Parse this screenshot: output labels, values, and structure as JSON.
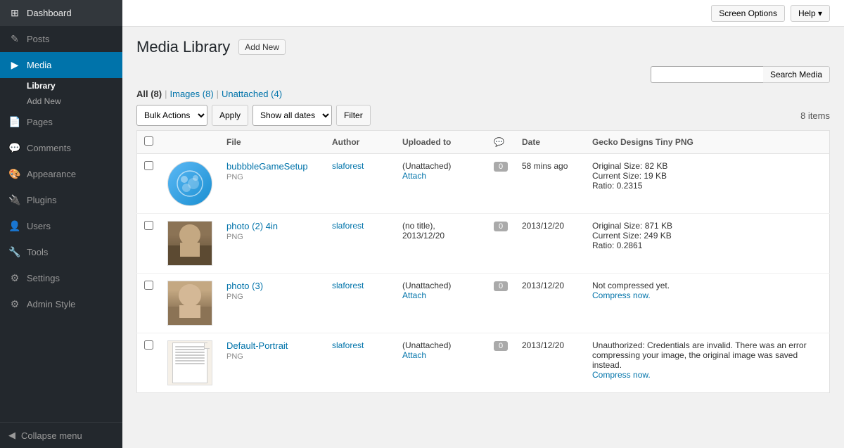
{
  "topbar": {
    "screen_options_label": "Screen Options",
    "help_label": "Help ▾"
  },
  "sidebar": {
    "items": [
      {
        "id": "dashboard",
        "label": "Dashboard",
        "icon": "⊞"
      },
      {
        "id": "posts",
        "label": "Posts",
        "icon": "✎"
      },
      {
        "id": "media",
        "label": "Media",
        "icon": "🖼",
        "active": true
      },
      {
        "id": "pages",
        "label": "Pages",
        "icon": "📄"
      },
      {
        "id": "comments",
        "label": "Comments",
        "icon": "💬"
      },
      {
        "id": "appearance",
        "label": "Appearance",
        "icon": "🎨"
      },
      {
        "id": "plugins",
        "label": "Plugins",
        "icon": "🔌"
      },
      {
        "id": "users",
        "label": "Users",
        "icon": "👤"
      },
      {
        "id": "tools",
        "label": "Tools",
        "icon": "🔧"
      },
      {
        "id": "settings",
        "label": "Settings",
        "icon": "⚙"
      },
      {
        "id": "admin-style",
        "label": "Admin Style",
        "icon": "⚙"
      }
    ],
    "media_sub": [
      {
        "id": "library",
        "label": "Library",
        "active": true
      },
      {
        "id": "add-new",
        "label": "Add New"
      }
    ],
    "collapse_label": "Collapse menu"
  },
  "page": {
    "title": "Media Library",
    "add_new_label": "Add New"
  },
  "search": {
    "placeholder": "",
    "button_label": "Search Media"
  },
  "filter_tabs": [
    {
      "id": "all",
      "label": "All",
      "count": "(8)",
      "active": true
    },
    {
      "id": "images",
      "label": "Images",
      "count": "(8)"
    },
    {
      "id": "unattached",
      "label": "Unattached",
      "count": "(4)"
    }
  ],
  "toolbar": {
    "bulk_actions_label": "Bulk Actions",
    "apply_label": "Apply",
    "show_dates_label": "Show all dates",
    "filter_label": "Filter",
    "item_count": "8 items"
  },
  "table": {
    "headers": {
      "file": "File",
      "author": "Author",
      "uploaded_to": "Uploaded to",
      "comment": "💬",
      "date": "Date",
      "gecko": "Gecko Designs Tiny PNG"
    },
    "rows": [
      {
        "id": "row1",
        "thumb_type": "bubble",
        "file_name": "bubbbleGameSetup",
        "file_type": "PNG",
        "author": "slaforest",
        "uploaded_status": "(Unattached)",
        "uploaded_link": "Attach",
        "comments": "0",
        "date": "58 mins ago",
        "gecko_info": "Original Size: 82 KB\nCurrent Size: 19 KB\nRatio: 0.2315"
      },
      {
        "id": "row2",
        "thumb_type": "face",
        "file_name": "photo (2) 4in",
        "file_type": "PNG",
        "author": "slaforest",
        "uploaded_status": "(no title),",
        "uploaded_date": "2013/12/20",
        "comments": "0",
        "date": "2013/12/20",
        "gecko_info": "Original Size: 871 KB\nCurrent Size: 249 KB\nRatio: 0.2861"
      },
      {
        "id": "row3",
        "thumb_type": "face2",
        "file_name": "photo (3)",
        "file_type": "PNG",
        "author": "slaforest",
        "uploaded_status": "(Unattached)",
        "uploaded_link": "Attach",
        "comments": "0",
        "date": "2013/12/20",
        "gecko_not_compressed": "Not compressed yet.",
        "gecko_link": "Compress now."
      },
      {
        "id": "row4",
        "thumb_type": "portrait",
        "file_name": "Default-Portrait",
        "file_type": "PNG",
        "author": "slaforest",
        "uploaded_status": "(Unattached)",
        "uploaded_link": "Attach",
        "comments": "0",
        "date": "2013/12/20",
        "gecko_error": "Unauthorized: Credentials are invalid. There was an error compressing your image, the original image was saved instead.",
        "gecko_link": "Compress now."
      }
    ]
  }
}
